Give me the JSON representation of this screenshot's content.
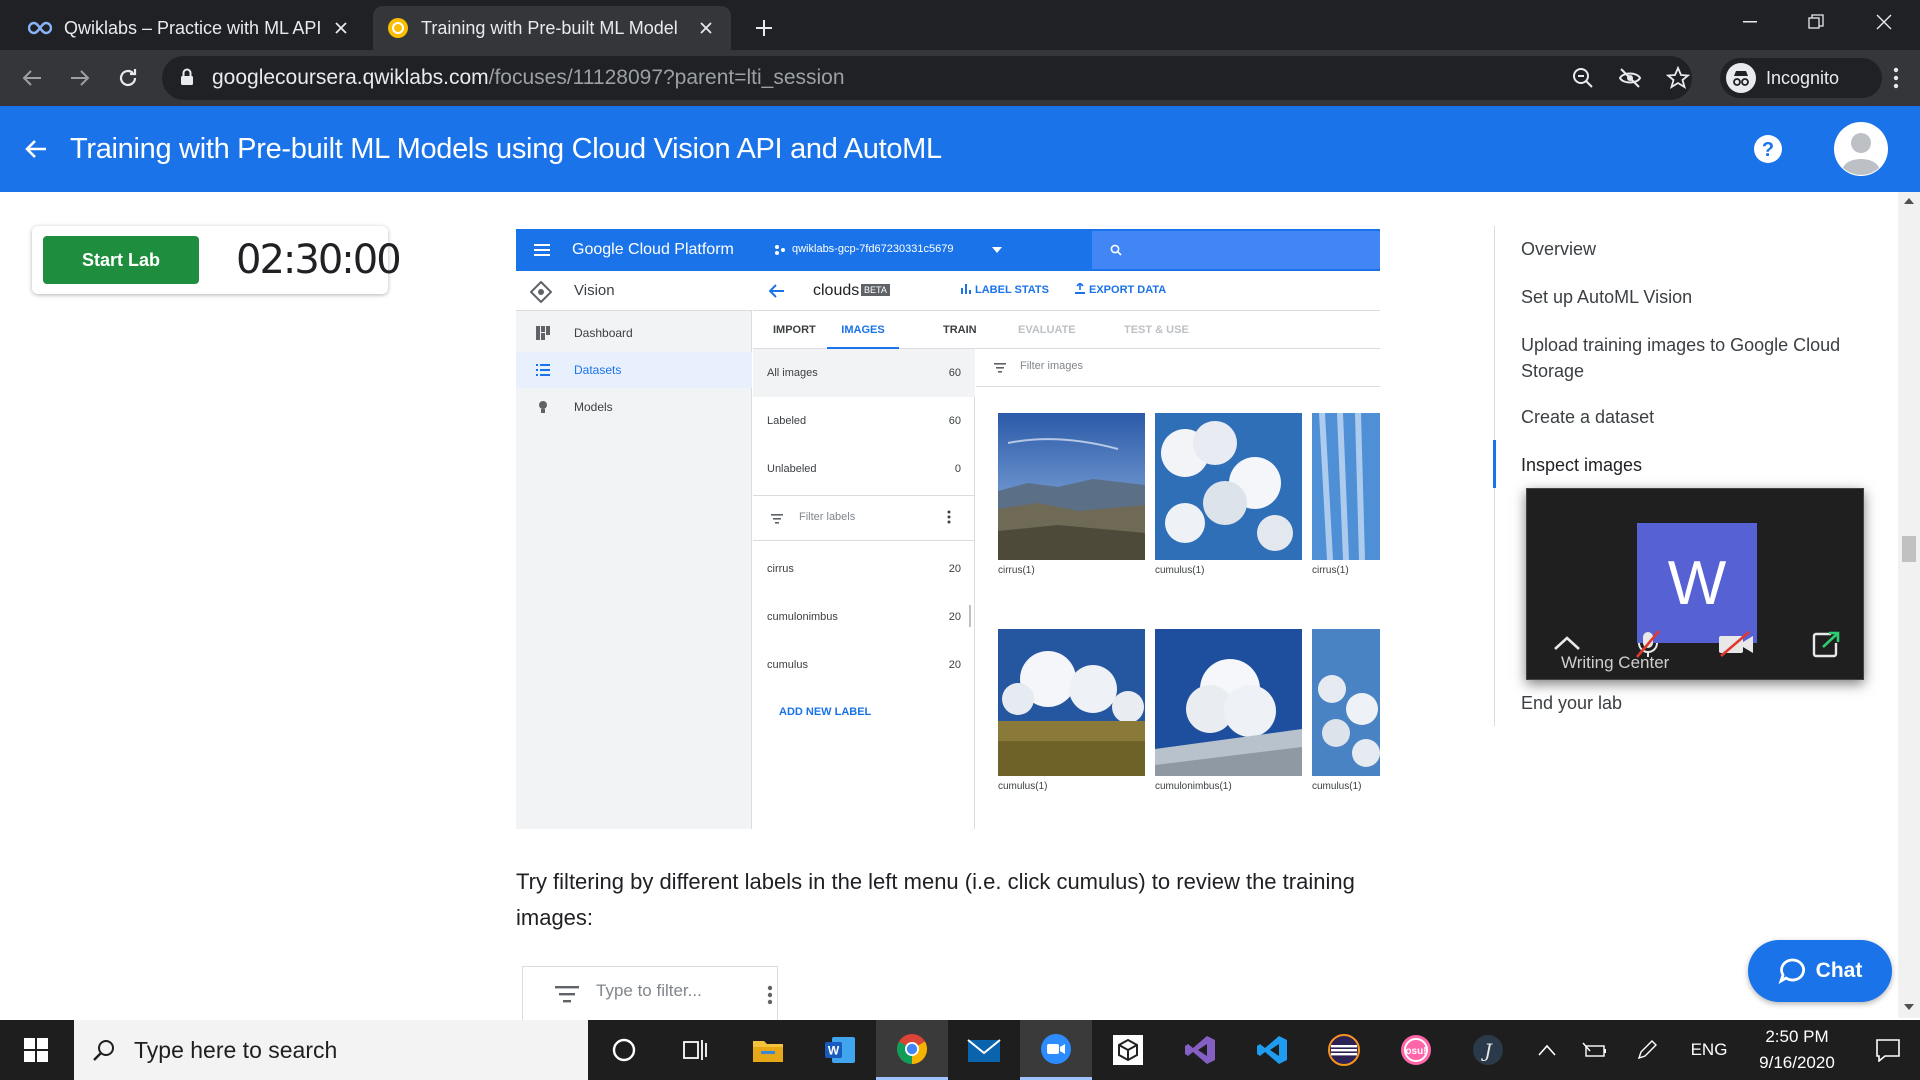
{
  "browser": {
    "tabs": [
      {
        "title": "Qwiklabs – Practice with ML APIs",
        "active": false
      },
      {
        "title": "Training with Pre-built ML Model",
        "active": true
      }
    ],
    "url_host": "googlecoursera.qwiklabs.com",
    "url_path": "/focuses/11128097?parent=lti_session",
    "profile_label": "Incognito"
  },
  "header": {
    "title": "Training with Pre-built ML Models using Cloud Vision API and AutoML"
  },
  "lab_card": {
    "start_label": "Start Lab",
    "timer": "02:30:00"
  },
  "gcp": {
    "brand": "Google Cloud Platform",
    "project": "qwiklabs-gcp-7fd67230331c5679",
    "product": "Vision",
    "side": [
      "Dashboard",
      "Datasets",
      "Models"
    ],
    "dataset": "clouds",
    "beta": "BETA",
    "label_stats": "LABEL STATS",
    "export_data": "EXPORT DATA",
    "tabs": [
      "IMPORT",
      "IMAGES",
      "TRAIN",
      "EVALUATE",
      "TEST & USE"
    ],
    "filter_images": "Filter images",
    "filter_labels": "Filter labels",
    "counts": [
      {
        "label": "All images",
        "count": "60"
      },
      {
        "label": "Labeled",
        "count": "60"
      },
      {
        "label": "Unlabeled",
        "count": "0"
      }
    ],
    "labels": [
      {
        "label": "cirrus",
        "count": "20"
      },
      {
        "label": "cumulonimbus",
        "count": "20"
      },
      {
        "label": "cumulus",
        "count": "20"
      }
    ],
    "add_label": "ADD NEW LABEL",
    "captions": [
      "cirrus(1)",
      "cumulus(1)",
      "cirrus(1)",
      "cumulus(1)",
      "cumulonimbus(1)",
      "cumulus(1)"
    ]
  },
  "body": {
    "instruction": "Try filtering by different labels in the left menu (i.e. click cumulus) to review the training images:",
    "filter_placeholder": "Type to filter..."
  },
  "toc": [
    "Overview",
    "Set up AutoML Vision",
    "Upload training images to Google Cloud Storage",
    "Create a dataset",
    "Inspect images",
    "End your lab"
  ],
  "zoom": {
    "initial": "W",
    "name": "Writing Center"
  },
  "chat_label": "Chat",
  "taskbar": {
    "search_placeholder": "Type here to search",
    "lang": "ENG",
    "time": "2:50 PM",
    "date": "9/16/2020"
  },
  "colors": {
    "primary": "#1a73e8",
    "start_green": "#1e8e3e",
    "chrome_dark": "#202124",
    "zoom_avatar": "#5662d4"
  }
}
